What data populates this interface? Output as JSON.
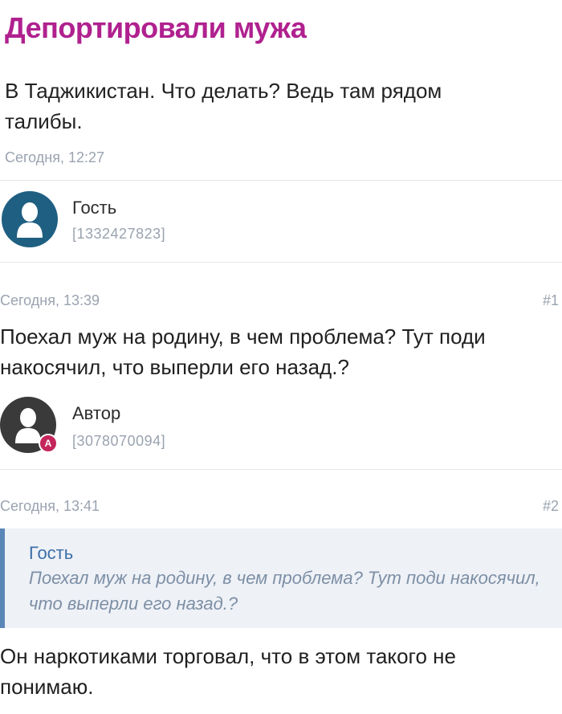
{
  "topic": {
    "title": "Депортировали мужа",
    "body": "В Таджикистан. Что делать? Ведь там рядом талибы.",
    "timestamp": "Сегодня, 12:27",
    "author": {
      "name": "Гость",
      "id": "[1332427823]",
      "avatar_icon": "user-silhouette-icon"
    }
  },
  "comments": [
    {
      "timestamp": "Сегодня, 13:39",
      "number": "#1",
      "text_lines": [
        "Поехал муж на родину, в чем проблема? Тут поди",
        "накосячил, что выперли его назад.?"
      ],
      "author": {
        "name": "Автор",
        "id": "[3078070094]",
        "badge": "A",
        "avatar_icon": "user-silhouette-icon"
      }
    },
    {
      "timestamp": "Сегодня, 13:41",
      "number": "#2",
      "quote": {
        "author": "Гость",
        "text": "Поехал муж на родину, в чем проблема? Тут поди накосячил, что выперли его назад.?"
      },
      "text_lines": [
        "Он наркотиками торговал, что в этом такого не",
        "понимаю."
      ]
    }
  ],
  "colors": {
    "title": "#b0218f",
    "guest_avatar": "#1f5f82",
    "author_avatar": "#3a3a3a",
    "badge": "#c4265c",
    "quote_bar": "#5b86b8",
    "muted": "#9aa3b0"
  }
}
